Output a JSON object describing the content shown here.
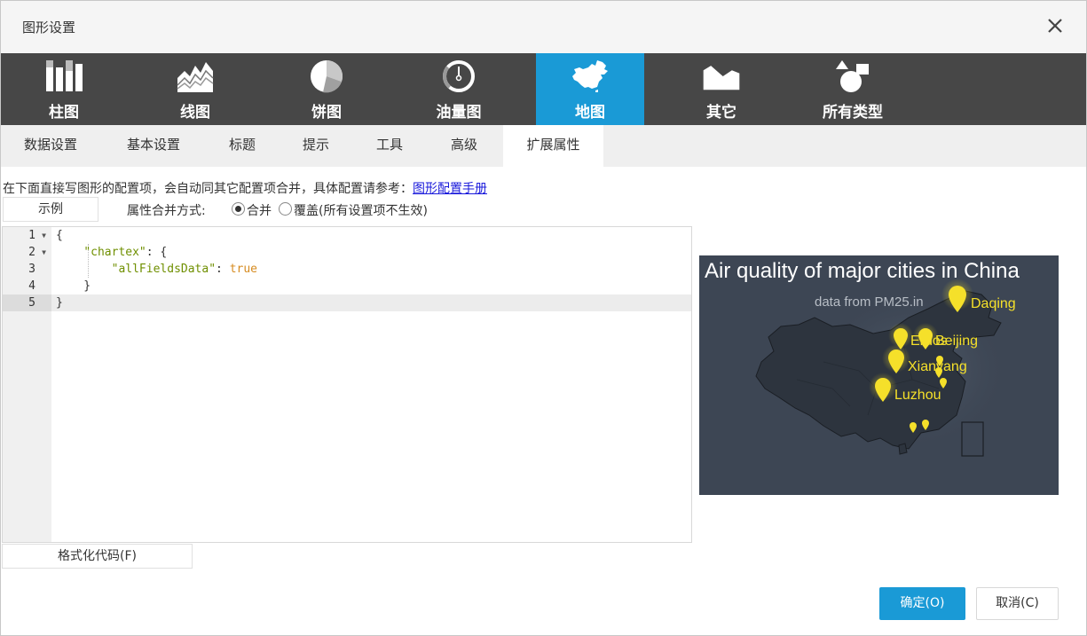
{
  "dialog": {
    "title": "图形设置",
    "close_icon": "close-icon"
  },
  "chart_types": [
    {
      "label": "柱图",
      "icon": "bar-chart-icon",
      "active": false
    },
    {
      "label": "线图",
      "icon": "line-chart-icon",
      "active": false
    },
    {
      "label": "饼图",
      "icon": "pie-chart-icon",
      "active": false
    },
    {
      "label": "油量图",
      "icon": "gauge-chart-icon",
      "active": false
    },
    {
      "label": "地图",
      "icon": "china-map-icon",
      "active": true
    },
    {
      "label": "其它",
      "icon": "other-chart-icon",
      "active": false
    },
    {
      "label": "所有类型",
      "icon": "all-types-icon",
      "active": false
    }
  ],
  "sub_tabs": [
    {
      "label": "数据设置",
      "active": false
    },
    {
      "label": "基本设置",
      "active": false
    },
    {
      "label": "标题",
      "active": false
    },
    {
      "label": "提示",
      "active": false
    },
    {
      "label": "工具",
      "active": false
    },
    {
      "label": "高级",
      "active": false
    },
    {
      "label": "扩展属性",
      "active": true
    }
  ],
  "hint": {
    "text": "在下面直接写图形的配置项，会自动同其它配置项合并，具体配置请参考：",
    "link": "图形配置手册"
  },
  "example_button": "示例",
  "merge_mode": {
    "label": "属性合并方式:",
    "options": [
      {
        "label": "合并",
        "checked": true
      },
      {
        "label": "覆盖(所有设置项不生效)",
        "checked": false
      }
    ]
  },
  "editor": {
    "lines": [
      {
        "num": "1",
        "fold": true,
        "active": false
      },
      {
        "num": "2",
        "fold": true,
        "active": false
      },
      {
        "num": "3",
        "fold": false,
        "active": false
      },
      {
        "num": "4",
        "fold": false,
        "active": false
      },
      {
        "num": "5",
        "fold": false,
        "active": true
      }
    ],
    "code": {
      "l1": "{",
      "l2_indent": "    ",
      "l2_key": "\"chartex\"",
      "l2_rest": ": {",
      "l3_indent": "        ",
      "l3_key": "\"allFieldsData\"",
      "l3_sep": ": ",
      "l3_val": "true",
      "l4": "    }",
      "l5": "}"
    }
  },
  "format_button": "格式化代码(F)",
  "preview": {
    "title": "Air quality of major cities in China",
    "subtitle": "data from PM25.in",
    "cities": [
      "Daqing",
      "Beijing",
      "Erdos",
      "Xianyang",
      "Luzhou"
    ],
    "background": "#3d4654",
    "marker_color": "#f5e02a"
  },
  "footer": {
    "ok": "确定(O)",
    "cancel": "取消(C)"
  },
  "colors": {
    "accent": "#1a9ad6",
    "toolbar": "#474747"
  }
}
